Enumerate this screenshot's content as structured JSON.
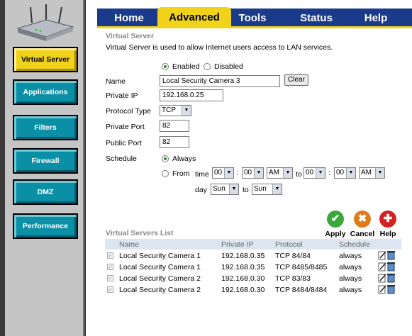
{
  "sidebar": {
    "items": [
      {
        "label": "Virtual Server",
        "active": true
      },
      {
        "label": "Applications",
        "active": false
      },
      {
        "label": "Filters",
        "active": false
      },
      {
        "label": "Firewall",
        "active": false
      },
      {
        "label": "DMZ",
        "active": false
      },
      {
        "label": "Performance",
        "active": false
      }
    ]
  },
  "tabs": [
    {
      "label": "Home",
      "active": false
    },
    {
      "label": "Advanced",
      "active": true
    },
    {
      "label": "Tools",
      "active": false
    },
    {
      "label": "Status",
      "active": false
    },
    {
      "label": "Help",
      "active": false
    }
  ],
  "section": {
    "title": "Virtual Server",
    "description": "Virtual Server is used to allow Internet users access to LAN services."
  },
  "form": {
    "enabled_label": "Enabled",
    "disabled_label": "Disabled",
    "enabled_selected": true,
    "name_label": "Name",
    "name_value": "Local Security Camera 3",
    "clear_label": "Clear",
    "private_ip_label": "Private IP",
    "private_ip_value": "192.168.0.25",
    "protocol_label": "Protocol Type",
    "protocol_value": "TCP",
    "private_port_label": "Private Port",
    "private_port_value": "82",
    "public_port_label": "Public Port",
    "public_port_value": "82",
    "schedule_label": "Schedule",
    "always_label": "Always",
    "always_selected": true,
    "from_label": "From",
    "time_label": "time",
    "from_hour": "00",
    "from_min": "00",
    "from_ampm": "AM",
    "to_label": "to",
    "to_hour": "00",
    "to_min": "00",
    "to_ampm": "AM",
    "colon": ":",
    "day_label": "day",
    "from_day": "Sun",
    "to_day": "Sun"
  },
  "actions": {
    "apply_label": "Apply",
    "cancel_label": "Cancel",
    "help_label": "Help",
    "apply_color": "#3aa83a",
    "cancel_color": "#e07a1a",
    "help_color": "#d42020"
  },
  "list": {
    "title": "Virtual Servers List",
    "headers": {
      "name": "Name",
      "private_ip": "Private IP",
      "protocol": "Protocol",
      "schedule": "Schedule"
    },
    "rows": [
      {
        "checked": true,
        "name": "Local Security Camera 1",
        "private_ip": "192.168.0.35",
        "protocol": "TCP 84/84",
        "schedule": "always"
      },
      {
        "checked": true,
        "name": "Local Security Camera 1",
        "private_ip": "192.168.0.35",
        "protocol": "TCP 8485/8485",
        "schedule": "always"
      },
      {
        "checked": true,
        "name": "Local Security Camera 2",
        "private_ip": "192.168.0.30",
        "protocol": "TCP 83/83",
        "schedule": "always"
      },
      {
        "checked": true,
        "name": "Local Security Camera 2",
        "private_ip": "192.168.0.30",
        "protocol": "TCP 8484/8484",
        "schedule": "always"
      }
    ]
  },
  "icons": {
    "check": "✓",
    "router": "router-icon",
    "edit": "edit-icon",
    "trash": "trash-icon"
  },
  "colors": {
    "sidebar_button": "#0b8fa6",
    "sidebar_active": "#f0d21a",
    "tabbar": "#1a3a8a",
    "list_header": "#dce6f0"
  }
}
